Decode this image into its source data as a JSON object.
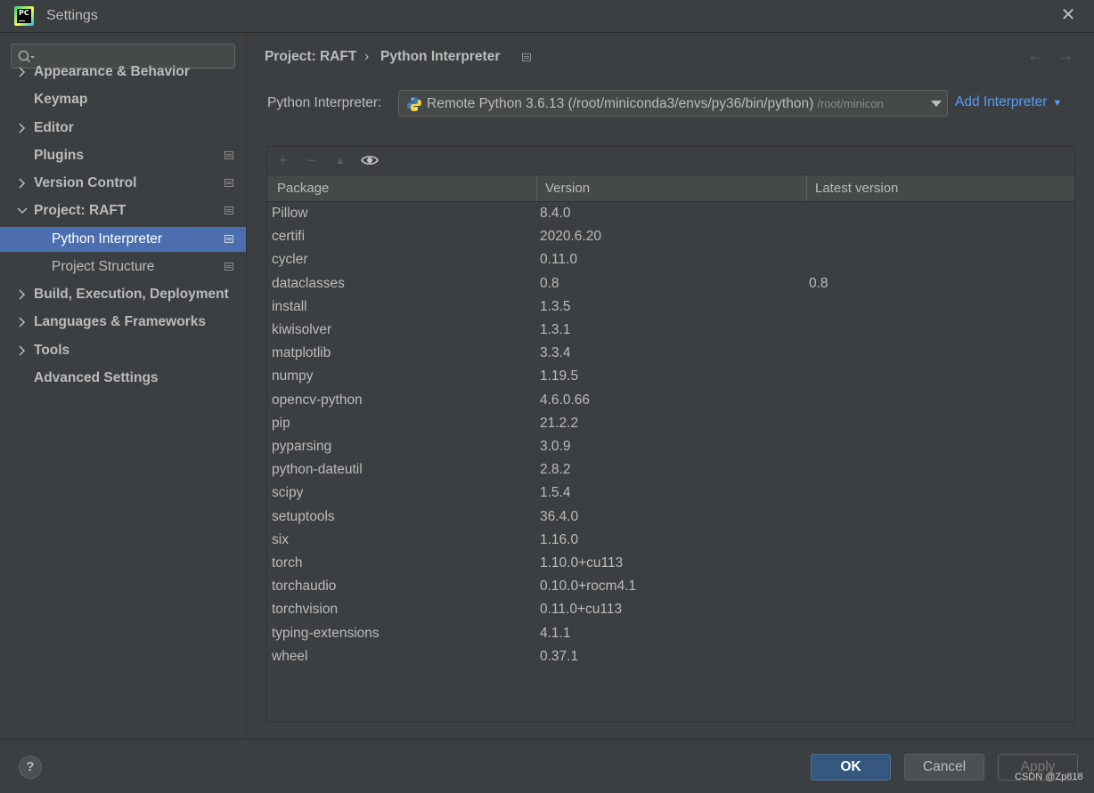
{
  "window": {
    "title": "Settings",
    "app_icon_text": "PC"
  },
  "sidebar": {
    "search_placeholder": "",
    "items": [
      {
        "label": "Appearance & Behavior",
        "expandable": true,
        "expanded": false
      },
      {
        "label": "Keymap",
        "expandable": false
      },
      {
        "label": "Editor",
        "expandable": true,
        "expanded": false
      },
      {
        "label": "Plugins",
        "expandable": false,
        "project_icon": true
      },
      {
        "label": "Version Control",
        "expandable": true,
        "expanded": false,
        "project_icon": true
      },
      {
        "label": "Project: RAFT",
        "expandable": true,
        "expanded": true,
        "project_icon": true
      },
      {
        "label": "Python Interpreter",
        "sub": true,
        "selected": true,
        "project_icon": true
      },
      {
        "label": "Project Structure",
        "sub": true,
        "project_icon": true
      },
      {
        "label": "Build, Execution, Deployment",
        "expandable": true,
        "expanded": false
      },
      {
        "label": "Languages & Frameworks",
        "expandable": true,
        "expanded": false
      },
      {
        "label": "Tools",
        "expandable": true,
        "expanded": false
      },
      {
        "label": "Advanced Settings",
        "expandable": false
      }
    ]
  },
  "breadcrumb": {
    "parent": "Project: RAFT",
    "separator": "›",
    "current": "Python Interpreter"
  },
  "interpreter": {
    "label": "Python Interpreter:",
    "value": "Remote Python 3.6.13 (/root/miniconda3/envs/py36/bin/python)",
    "path_hint": "/root/minicon",
    "add_label": "Add Interpreter"
  },
  "packages": {
    "columns": [
      "Package",
      "Version",
      "Latest version"
    ],
    "rows": [
      [
        "Pillow",
        "8.4.0",
        ""
      ],
      [
        "certifi",
        "2020.6.20",
        ""
      ],
      [
        "cycler",
        "0.11.0",
        ""
      ],
      [
        "dataclasses",
        "0.8",
        "0.8"
      ],
      [
        "install",
        "1.3.5",
        ""
      ],
      [
        "kiwisolver",
        "1.3.1",
        ""
      ],
      [
        "matplotlib",
        "3.3.4",
        ""
      ],
      [
        "numpy",
        "1.19.5",
        ""
      ],
      [
        "opencv-python",
        "4.6.0.66",
        ""
      ],
      [
        "pip",
        "21.2.2",
        ""
      ],
      [
        "pyparsing",
        "3.0.9",
        ""
      ],
      [
        "python-dateutil",
        "2.8.2",
        ""
      ],
      [
        "scipy",
        "1.5.4",
        ""
      ],
      [
        "setuptools",
        "36.4.0",
        ""
      ],
      [
        "six",
        "1.16.0",
        ""
      ],
      [
        "torch",
        "1.10.0+cu113",
        ""
      ],
      [
        "torchaudio",
        "0.10.0+rocm4.1",
        ""
      ],
      [
        "torchvision",
        "0.11.0+cu113",
        ""
      ],
      [
        "typing-extensions",
        "4.1.1",
        ""
      ],
      [
        "wheel",
        "0.37.1",
        ""
      ]
    ]
  },
  "footer": {
    "help": "?",
    "ok": "OK",
    "cancel": "Cancel",
    "apply": "Apply"
  },
  "watermark": "CSDN @Zp818",
  "colors": {
    "accent": "#4b6eaf",
    "link": "#589df6",
    "ok_button": "#365880",
    "background": "#3c3f41"
  },
  "icons": [
    "app-logo-icon",
    "close-icon",
    "search-icon",
    "chevron-right-icon",
    "chevron-down-icon",
    "project-scope-icon",
    "back-arrow-icon",
    "forward-arrow-icon",
    "python-icon",
    "dropdown-arrow-icon",
    "plus-icon",
    "minus-icon",
    "upgrade-icon",
    "eye-icon",
    "help-icon"
  ]
}
